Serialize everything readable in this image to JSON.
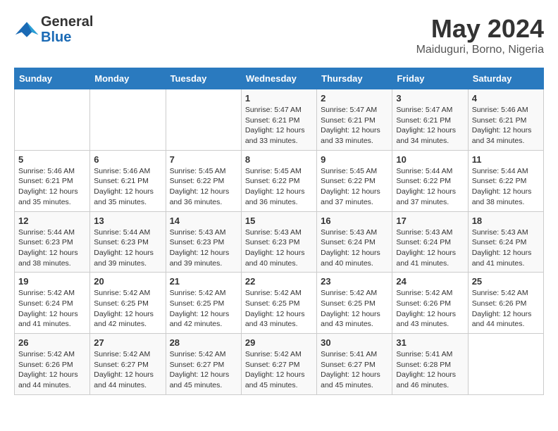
{
  "logo": {
    "line1": "General",
    "line2": "Blue"
  },
  "title": "May 2024",
  "subtitle": "Maiduguri, Borno, Nigeria",
  "days_of_week": [
    "Sunday",
    "Monday",
    "Tuesday",
    "Wednesday",
    "Thursday",
    "Friday",
    "Saturday"
  ],
  "weeks": [
    [
      {
        "num": "",
        "detail": ""
      },
      {
        "num": "",
        "detail": ""
      },
      {
        "num": "",
        "detail": ""
      },
      {
        "num": "1",
        "detail": "Sunrise: 5:47 AM\nSunset: 6:21 PM\nDaylight: 12 hours\nand 33 minutes."
      },
      {
        "num": "2",
        "detail": "Sunrise: 5:47 AM\nSunset: 6:21 PM\nDaylight: 12 hours\nand 33 minutes."
      },
      {
        "num": "3",
        "detail": "Sunrise: 5:47 AM\nSunset: 6:21 PM\nDaylight: 12 hours\nand 34 minutes."
      },
      {
        "num": "4",
        "detail": "Sunrise: 5:46 AM\nSunset: 6:21 PM\nDaylight: 12 hours\nand 34 minutes."
      }
    ],
    [
      {
        "num": "5",
        "detail": "Sunrise: 5:46 AM\nSunset: 6:21 PM\nDaylight: 12 hours\nand 35 minutes."
      },
      {
        "num": "6",
        "detail": "Sunrise: 5:46 AM\nSunset: 6:21 PM\nDaylight: 12 hours\nand 35 minutes."
      },
      {
        "num": "7",
        "detail": "Sunrise: 5:45 AM\nSunset: 6:22 PM\nDaylight: 12 hours\nand 36 minutes."
      },
      {
        "num": "8",
        "detail": "Sunrise: 5:45 AM\nSunset: 6:22 PM\nDaylight: 12 hours\nand 36 minutes."
      },
      {
        "num": "9",
        "detail": "Sunrise: 5:45 AM\nSunset: 6:22 PM\nDaylight: 12 hours\nand 37 minutes."
      },
      {
        "num": "10",
        "detail": "Sunrise: 5:44 AM\nSunset: 6:22 PM\nDaylight: 12 hours\nand 37 minutes."
      },
      {
        "num": "11",
        "detail": "Sunrise: 5:44 AM\nSunset: 6:22 PM\nDaylight: 12 hours\nand 38 minutes."
      }
    ],
    [
      {
        "num": "12",
        "detail": "Sunrise: 5:44 AM\nSunset: 6:23 PM\nDaylight: 12 hours\nand 38 minutes."
      },
      {
        "num": "13",
        "detail": "Sunrise: 5:44 AM\nSunset: 6:23 PM\nDaylight: 12 hours\nand 39 minutes."
      },
      {
        "num": "14",
        "detail": "Sunrise: 5:43 AM\nSunset: 6:23 PM\nDaylight: 12 hours\nand 39 minutes."
      },
      {
        "num": "15",
        "detail": "Sunrise: 5:43 AM\nSunset: 6:23 PM\nDaylight: 12 hours\nand 40 minutes."
      },
      {
        "num": "16",
        "detail": "Sunrise: 5:43 AM\nSunset: 6:24 PM\nDaylight: 12 hours\nand 40 minutes."
      },
      {
        "num": "17",
        "detail": "Sunrise: 5:43 AM\nSunset: 6:24 PM\nDaylight: 12 hours\nand 41 minutes."
      },
      {
        "num": "18",
        "detail": "Sunrise: 5:43 AM\nSunset: 6:24 PM\nDaylight: 12 hours\nand 41 minutes."
      }
    ],
    [
      {
        "num": "19",
        "detail": "Sunrise: 5:42 AM\nSunset: 6:24 PM\nDaylight: 12 hours\nand 41 minutes."
      },
      {
        "num": "20",
        "detail": "Sunrise: 5:42 AM\nSunset: 6:25 PM\nDaylight: 12 hours\nand 42 minutes."
      },
      {
        "num": "21",
        "detail": "Sunrise: 5:42 AM\nSunset: 6:25 PM\nDaylight: 12 hours\nand 42 minutes."
      },
      {
        "num": "22",
        "detail": "Sunrise: 5:42 AM\nSunset: 6:25 PM\nDaylight: 12 hours\nand 43 minutes."
      },
      {
        "num": "23",
        "detail": "Sunrise: 5:42 AM\nSunset: 6:25 PM\nDaylight: 12 hours\nand 43 minutes."
      },
      {
        "num": "24",
        "detail": "Sunrise: 5:42 AM\nSunset: 6:26 PM\nDaylight: 12 hours\nand 43 minutes."
      },
      {
        "num": "25",
        "detail": "Sunrise: 5:42 AM\nSunset: 6:26 PM\nDaylight: 12 hours\nand 44 minutes."
      }
    ],
    [
      {
        "num": "26",
        "detail": "Sunrise: 5:42 AM\nSunset: 6:26 PM\nDaylight: 12 hours\nand 44 minutes."
      },
      {
        "num": "27",
        "detail": "Sunrise: 5:42 AM\nSunset: 6:27 PM\nDaylight: 12 hours\nand 44 minutes."
      },
      {
        "num": "28",
        "detail": "Sunrise: 5:42 AM\nSunset: 6:27 PM\nDaylight: 12 hours\nand 45 minutes."
      },
      {
        "num": "29",
        "detail": "Sunrise: 5:42 AM\nSunset: 6:27 PM\nDaylight: 12 hours\nand 45 minutes."
      },
      {
        "num": "30",
        "detail": "Sunrise: 5:41 AM\nSunset: 6:27 PM\nDaylight: 12 hours\nand 45 minutes."
      },
      {
        "num": "31",
        "detail": "Sunrise: 5:41 AM\nSunset: 6:28 PM\nDaylight: 12 hours\nand 46 minutes."
      },
      {
        "num": "",
        "detail": ""
      }
    ]
  ]
}
